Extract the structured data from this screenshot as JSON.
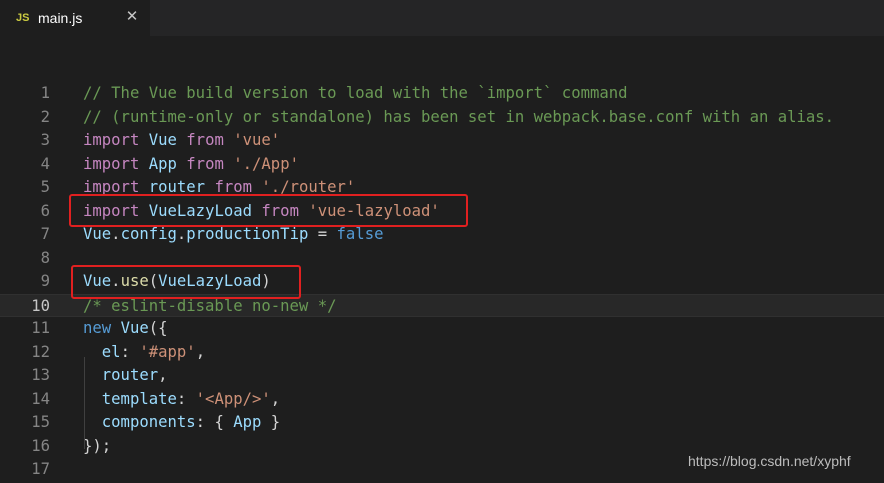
{
  "tab": {
    "icon_text": "JS",
    "label": "main.js",
    "close_icon": "close-icon"
  },
  "editor": {
    "current_line": 10,
    "lines": [
      {
        "num": "1",
        "tokens": [
          {
            "t": "// The Vue build version to load with the `import` command",
            "c": "comment"
          }
        ]
      },
      {
        "num": "2",
        "tokens": [
          {
            "t": "// (runtime-only or standalone) has been set in webpack.base.conf with an alias.",
            "c": "comment"
          }
        ]
      },
      {
        "num": "3",
        "tokens": [
          {
            "t": "import",
            "c": "keyword"
          },
          {
            "t": " ",
            "c": "plain"
          },
          {
            "t": "Vue",
            "c": "ident"
          },
          {
            "t": " ",
            "c": "plain"
          },
          {
            "t": "from",
            "c": "keyword"
          },
          {
            "t": " ",
            "c": "plain"
          },
          {
            "t": "'vue'",
            "c": "string"
          }
        ]
      },
      {
        "num": "4",
        "tokens": [
          {
            "t": "import",
            "c": "keyword"
          },
          {
            "t": " ",
            "c": "plain"
          },
          {
            "t": "App",
            "c": "ident"
          },
          {
            "t": " ",
            "c": "plain"
          },
          {
            "t": "from",
            "c": "keyword"
          },
          {
            "t": " ",
            "c": "plain"
          },
          {
            "t": "'./App'",
            "c": "string"
          }
        ]
      },
      {
        "num": "5",
        "tokens": [
          {
            "t": "import",
            "c": "keyword"
          },
          {
            "t": " ",
            "c": "plain"
          },
          {
            "t": "router",
            "c": "ident"
          },
          {
            "t": " ",
            "c": "plain"
          },
          {
            "t": "from",
            "c": "keyword"
          },
          {
            "t": " ",
            "c": "plain"
          },
          {
            "t": "'./router'",
            "c": "string"
          }
        ]
      },
      {
        "num": "6",
        "tokens": [
          {
            "t": "import",
            "c": "keyword"
          },
          {
            "t": " ",
            "c": "plain"
          },
          {
            "t": "VueLazyLoad",
            "c": "ident"
          },
          {
            "t": " ",
            "c": "plain"
          },
          {
            "t": "from",
            "c": "keyword"
          },
          {
            "t": " ",
            "c": "plain"
          },
          {
            "t": "'vue-lazyload'",
            "c": "string"
          }
        ]
      },
      {
        "num": "7",
        "tokens": [
          {
            "t": "Vue",
            "c": "ident"
          },
          {
            "t": ".",
            "c": "plain"
          },
          {
            "t": "config",
            "c": "ident"
          },
          {
            "t": ".",
            "c": "plain"
          },
          {
            "t": "productionTip",
            "c": "ident"
          },
          {
            "t": " = ",
            "c": "plain"
          },
          {
            "t": "false",
            "c": "const"
          }
        ]
      },
      {
        "num": "8",
        "tokens": []
      },
      {
        "num": "9",
        "tokens": [
          {
            "t": "Vue",
            "c": "ident"
          },
          {
            "t": ".",
            "c": "plain"
          },
          {
            "t": "use",
            "c": "func"
          },
          {
            "t": "(",
            "c": "plain"
          },
          {
            "t": "VueLazyLoad",
            "c": "ident"
          },
          {
            "t": ")",
            "c": "plain"
          }
        ]
      },
      {
        "num": "10",
        "tokens": [
          {
            "t": "/* eslint-disable no-new */",
            "c": "comment"
          }
        ]
      },
      {
        "num": "11",
        "tokens": [
          {
            "t": "new",
            "c": "const"
          },
          {
            "t": " ",
            "c": "plain"
          },
          {
            "t": "Vue",
            "c": "ident"
          },
          {
            "t": "({",
            "c": "plain"
          }
        ]
      },
      {
        "num": "12",
        "tokens": [
          {
            "t": "  ",
            "c": "plain"
          },
          {
            "t": "el",
            "c": "ident"
          },
          {
            "t": ": ",
            "c": "plain"
          },
          {
            "t": "'#app'",
            "c": "string"
          },
          {
            "t": ",",
            "c": "plain"
          }
        ]
      },
      {
        "num": "13",
        "tokens": [
          {
            "t": "  ",
            "c": "plain"
          },
          {
            "t": "router",
            "c": "ident"
          },
          {
            "t": ",",
            "c": "plain"
          }
        ]
      },
      {
        "num": "14",
        "tokens": [
          {
            "t": "  ",
            "c": "plain"
          },
          {
            "t": "template",
            "c": "ident"
          },
          {
            "t": ": ",
            "c": "plain"
          },
          {
            "t": "'<App/>'",
            "c": "string"
          },
          {
            "t": ",",
            "c": "plain"
          }
        ]
      },
      {
        "num": "15",
        "tokens": [
          {
            "t": "  ",
            "c": "plain"
          },
          {
            "t": "components",
            "c": "ident"
          },
          {
            "t": ": { ",
            "c": "plain"
          },
          {
            "t": "App",
            "c": "ident"
          },
          {
            "t": " }",
            "c": "plain"
          }
        ]
      },
      {
        "num": "16",
        "tokens": [
          {
            "t": "});",
            "c": "plain"
          }
        ]
      },
      {
        "num": "17",
        "tokens": []
      }
    ]
  },
  "annotations": {
    "highlight_color": "#e02020"
  },
  "watermark": "https://blog.csdn.net/xyphf"
}
